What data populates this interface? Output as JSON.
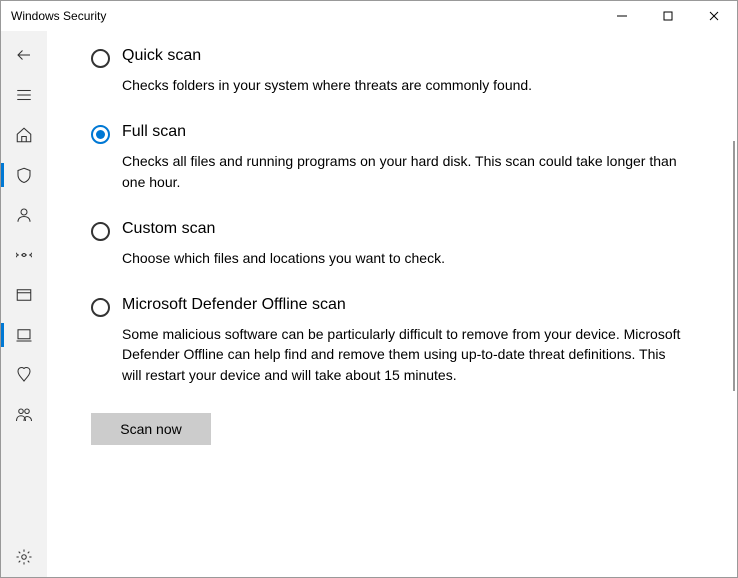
{
  "window": {
    "title": "Windows Security"
  },
  "sidebar": {
    "active_index": 2
  },
  "options": [
    {
      "id": "quick",
      "title": "Quick scan",
      "desc": "Checks folders in your system where threats are commonly found.",
      "selected": false
    },
    {
      "id": "full",
      "title": "Full scan",
      "desc": "Checks all files and running programs on your hard disk. This scan could take longer than one hour.",
      "selected": true
    },
    {
      "id": "custom",
      "title": "Custom scan",
      "desc": "Choose which files and locations you want to check.",
      "selected": false
    },
    {
      "id": "offline",
      "title": "Microsoft Defender Offline scan",
      "desc": "Some malicious software can be particularly difficult to remove from your device. Microsoft Defender Offline can help find and remove them using up-to-date threat definitions. This will restart your device and will take about 15 minutes.",
      "selected": false
    }
  ],
  "buttons": {
    "scan_now": "Scan now"
  }
}
